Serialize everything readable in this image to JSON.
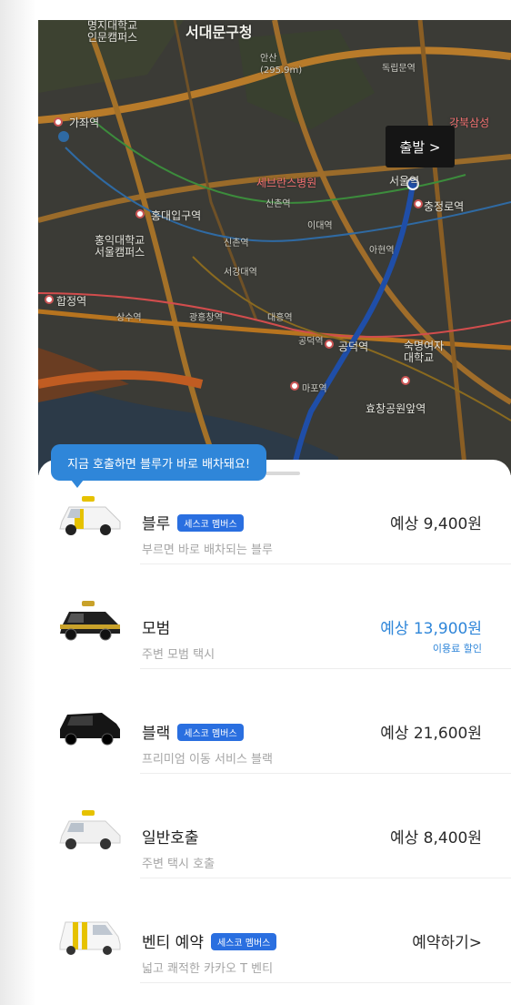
{
  "map": {
    "labels": {
      "univ_campus": "명지대학교\n인문캠퍼스",
      "district_office": "서대문구청",
      "mountain": "안산\n(295.9m)",
      "gajwa": "가좌역",
      "hongik_station": "홍대입구역",
      "severance": "세브란스병원",
      "hongik_univ": "홍익대학교\n서울캠퍼스",
      "hapjeong": "합정역",
      "sinchon": "신촌역",
      "ewha": "이대역",
      "gongdeok": "공덕역",
      "hyochang": "효창공원앞역",
      "ahyeon": "아현역",
      "chungjeongno": "충정로역",
      "sookmyung": "숙명여자\n대학교",
      "gangbuk_samsung": "강북삼성",
      "dongnimmun": "독립문역",
      "mapo": "마포역",
      "seoul_station": "서울역",
      "daeheung": "대흥역",
      "gwangheungchang": "광흥창역",
      "sangsu": "상수역",
      "seogang": "서강대역",
      "gongdeok2": "공덕역",
      "sinchon2": "신촌역"
    },
    "depart_label": "출발 >"
  },
  "tooltip": "지금 호출하면 블루가 바로 배차돼요!",
  "options": [
    {
      "name": "블루",
      "badge": "세스코 멤버스",
      "desc": "부르면 바로 배차되는 블루",
      "price": "예상 9,400원",
      "discount": "",
      "car": "blue"
    },
    {
      "name": "모범",
      "badge": "",
      "desc": "주변 모범 택시",
      "price": "예상 13,900원",
      "discount": "이용료 할인",
      "car": "deluxe"
    },
    {
      "name": "블랙",
      "badge": "세스코 멤버스",
      "desc": "프리미엄 이동 서비스 블랙",
      "price": "예상 21,600원",
      "discount": "",
      "car": "black"
    },
    {
      "name": "일반호출",
      "badge": "",
      "desc": "주변 택시 호출",
      "price": "예상 8,400원",
      "discount": "",
      "car": "normal"
    },
    {
      "name": "벤티 예약",
      "badge": "세스코 멤버스",
      "desc": "넓고 쾌적한 카카오 T 벤티",
      "price": "예약하기>",
      "discount": "",
      "car": "venti"
    }
  ],
  "colors": {
    "accent": "#2f86d9",
    "badge": "#2a6fe0",
    "map_bg": "#3b3b36",
    "route": "#1f4ea8"
  }
}
